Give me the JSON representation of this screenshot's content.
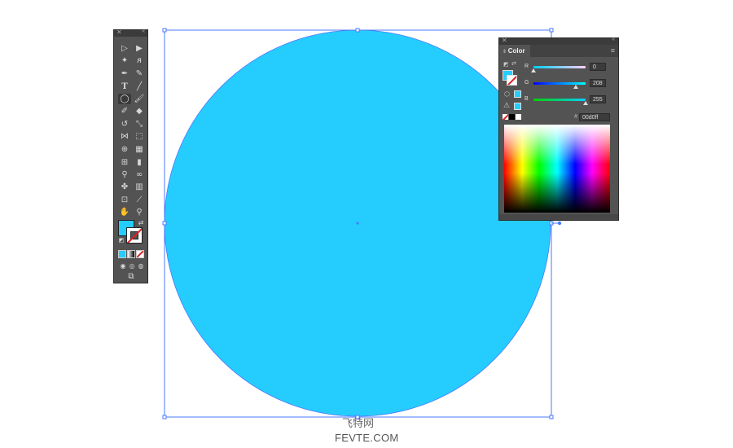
{
  "colors": {
    "fill": "#25cdfe",
    "selection": "#4a79ff",
    "panel_bg": "#535353",
    "stroke_none_slash": "#e02020"
  },
  "toolbar": {
    "tools": [
      "selection-tool-icon",
      "direct-selection-tool-icon",
      "magic-wand-tool-icon",
      "lasso-tool-icon",
      "pen-tool-icon",
      "curvature-tool-icon",
      "type-tool-icon",
      "line-segment-tool-icon",
      "ellipse-tool-icon",
      "paintbrush-tool-icon",
      "shaper-tool-icon",
      "eraser-tool-icon",
      "rotate-tool-icon",
      "scale-tool-icon",
      "width-tool-icon",
      "free-transform-tool-icon",
      "shape-builder-tool-icon",
      "perspective-grid-tool-icon",
      "mesh-tool-icon",
      "gradient-tool-icon",
      "eyedropper-tool-icon",
      "blend-tool-icon",
      "symbol-sprayer-tool-icon",
      "column-graph-tool-icon",
      "artboard-tool-icon",
      "slice-tool-icon",
      "hand-tool-icon",
      "zoom-tool-icon"
    ],
    "active_tool": "ellipse-tool-icon"
  },
  "color_panel": {
    "tab_label": "Color",
    "channels": [
      {
        "label": "R",
        "value": "0"
      },
      {
        "label": "G",
        "value": "208"
      },
      {
        "label": "B",
        "value": "255"
      }
    ],
    "hash_symbol": "#",
    "hex_value": "00d0ff"
  },
  "watermark": {
    "line1": "飞特网",
    "line2": "FEVTE.COM"
  }
}
